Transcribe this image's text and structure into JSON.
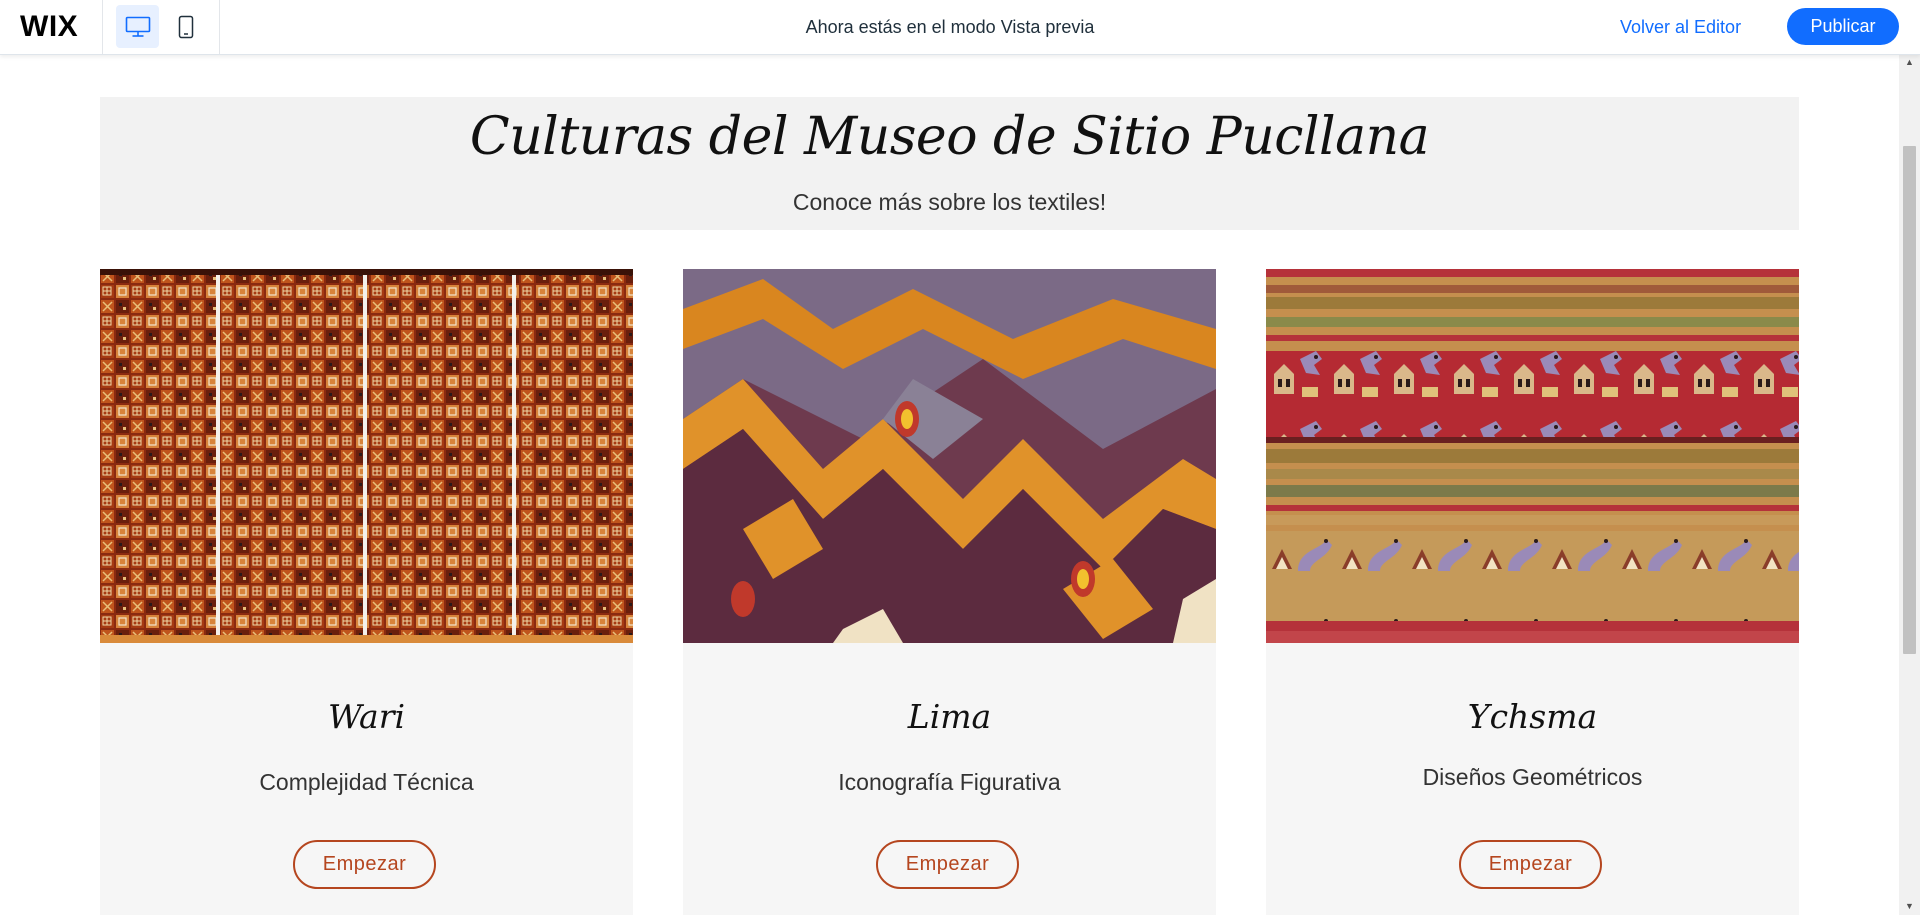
{
  "topbar": {
    "logo": "WIX",
    "devices": [
      {
        "name": "desktop",
        "icon": "desktop-icon",
        "active": true
      },
      {
        "name": "mobile",
        "icon": "mobile-phone-icon",
        "active": false
      }
    ],
    "preview_message": "Ahora estás en el modo Vista previa",
    "back_to_editor": "Volver al Editor",
    "publish": "Publicar",
    "accent_color": "#116dff"
  },
  "banner": {
    "title": "Culturas del Museo de Sitio Pucllana",
    "subtitle": "Conoce más sobre los textiles!"
  },
  "cards": [
    {
      "title": "Wari",
      "subtitle": "Complejidad Técnica",
      "button": "Empezar",
      "image": "wari-textile-image"
    },
    {
      "title": "Lima",
      "subtitle": "Iconografía Figurativa",
      "button": "Empezar",
      "image": "lima-textile-image"
    },
    {
      "title": "Ychsma",
      "subtitle": "Diseños Geométricos",
      "button": "Empezar",
      "image": "ychsma-textile-image"
    }
  ],
  "colors": {
    "button_border": "#b5461f",
    "banner_bg": "#f2f2f2",
    "card_bg": "#f6f6f6"
  }
}
